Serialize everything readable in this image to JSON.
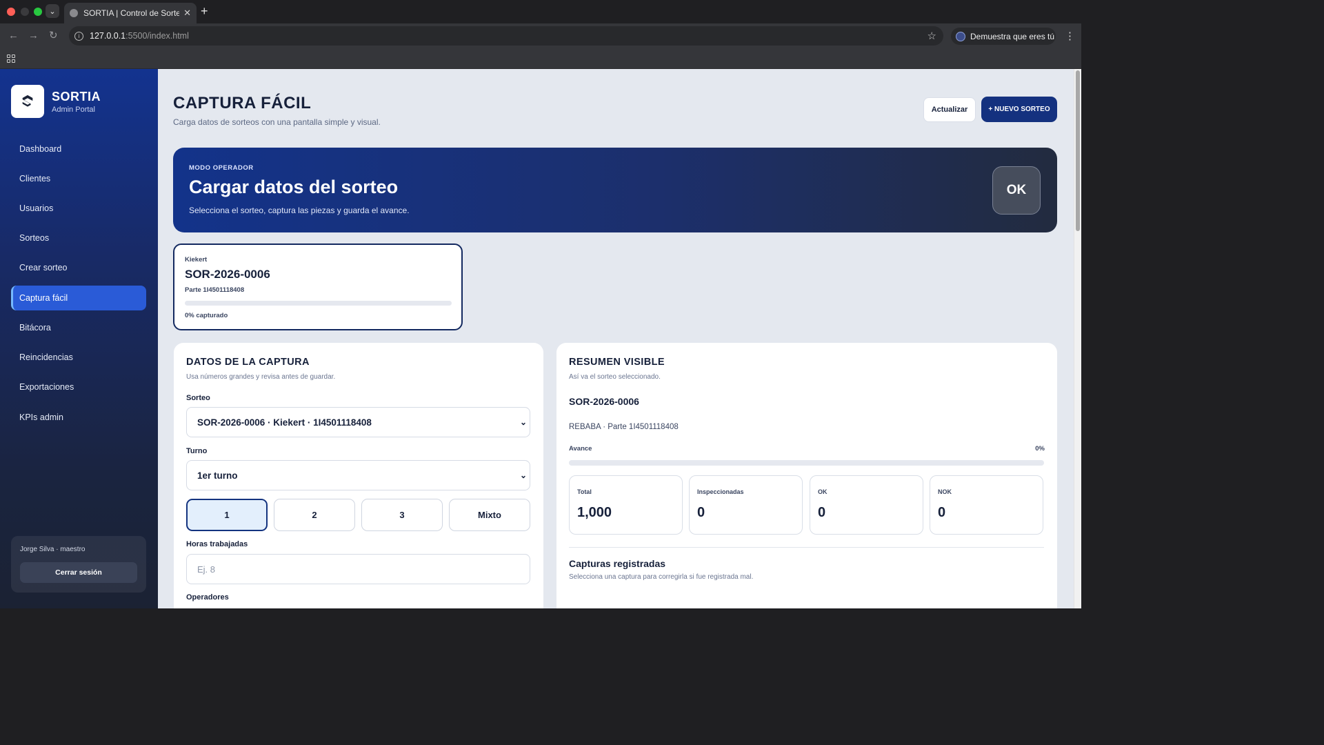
{
  "browser": {
    "tab_title": "SORTIA | Control de Sorteos",
    "tab_close": "✕",
    "new_tab": "+",
    "url_host": "127.0.0.1",
    "url_path": ":5500/index.html",
    "profile_label": "Demuestra que eres tú"
  },
  "sidebar": {
    "brand_name": "SORTIA",
    "brand_subtitle": "Admin Portal",
    "items": [
      {
        "label": "Dashboard"
      },
      {
        "label": "Clientes"
      },
      {
        "label": "Usuarios"
      },
      {
        "label": "Sorteos"
      },
      {
        "label": "Crear sorteo"
      },
      {
        "label": "Captura fácil",
        "active": true
      },
      {
        "label": "Bitácora"
      },
      {
        "label": "Reincidencias"
      },
      {
        "label": "Exportaciones"
      },
      {
        "label": "KPIs admin"
      }
    ],
    "user_label": "Jorge Silva · maestro",
    "logout_label": "Cerrar sesión"
  },
  "header": {
    "title": "CAPTURA FÁCIL",
    "subtitle": "Carga datos de sorteos con una pantalla simple y visual.",
    "refresh_label": "Actualizar",
    "new_label": "+ NUEVO SORTEO"
  },
  "hero": {
    "kicker": "MODO OPERADOR",
    "title": "Cargar datos del sorteo",
    "subtitle": "Selecciona el sorteo, captura las piezas y guarda el avance.",
    "badge": "OK"
  },
  "sorteo_card": {
    "client": "Kiekert",
    "id": "SOR-2026-0006",
    "part": "Parte 1I4501118408",
    "progress": 0,
    "progress_label": "0% capturado"
  },
  "form": {
    "title": "DATOS DE LA CAPTURA",
    "subtitle": "Usa números grandes y revisa antes de guardar.",
    "sorteo_label": "Sorteo",
    "sorteo_value": "SOR-2026-0006 · Kiekert · 1I4501118408",
    "turno_label": "Turno",
    "turno_value": "1er turno",
    "shift_buttons": [
      "1",
      "2",
      "3",
      "Mixto"
    ],
    "shift_selected": "1",
    "horas_label": "Horas trabajadas",
    "horas_placeholder": "Ej. 8",
    "operadores_label": "Operadores"
  },
  "summary": {
    "title": "RESUMEN VISIBLE",
    "subtitle": "Así va el sorteo seleccionado.",
    "sorteo_id": "SOR-2026-0006",
    "defect_part": "REBABA · Parte 1I4501118408",
    "avance_label": "Avance",
    "avance_pct": "0%",
    "avance_value": 0,
    "stats": [
      {
        "label": "Total",
        "value": "1,000"
      },
      {
        "label": "Inspeccionadas",
        "value": "0"
      },
      {
        "label": "OK",
        "value": "0"
      },
      {
        "label": "NOK",
        "value": "0"
      }
    ],
    "captures_title": "Capturas registradas",
    "captures_subtitle": "Selecciona una captura para corregirla si fue registrada mal."
  }
}
